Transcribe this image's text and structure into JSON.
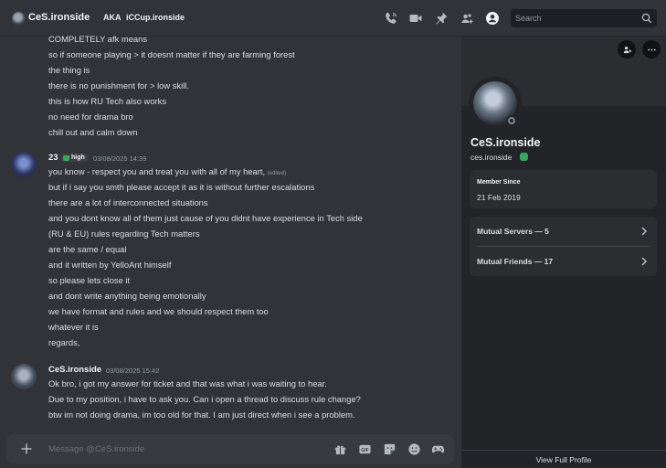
{
  "header": {
    "name": "CeS.ironside",
    "aka_label": "AKA",
    "alias": "iCCup.ironside",
    "icons": [
      "voice-call-icon",
      "video-call-icon",
      "pin-icon",
      "add-friends-icon",
      "user-profile-icon"
    ],
    "search_placeholder": "Search"
  },
  "messages": {
    "block0": [
      "COMPLETELY afk means",
      "so if someone playing > it doesnt matter if they are farming forest",
      "the thing is",
      "there is no punishment for > low skill.",
      "this is how RU Tech also works",
      "no need for drama bro",
      "chill out and calm down"
    ],
    "msg1": {
      "author": "23",
      "tag": "high",
      "timestamp": "03/08/2025 14:39",
      "first_line": "you know - respect you and treat you with all of my heart,",
      "edited": "(edited)",
      "lines": [
        "but if i say you smth please accept it as it is without further escalations",
        "there are a lot of interconnected situations",
        "and you dont know all of them just cause of you didnt have experience in Tech side",
        "(RU & EU) rules regarding Tech matters",
        "are the same / equal",
        "and it written by YelloAnt himself",
        "so please lets close it",
        "and dont write anything being emotionally",
        "we have format and rules and we should respect them too",
        "whatever it is",
        "regards,"
      ]
    },
    "msg2": {
      "author": "CeS.ironside",
      "timestamp": "03/08/2025 15:42",
      "lines": [
        "Ok bro, i got my answer for ticket and that was what i was waiting to hear.",
        "Due to my position, i have to ask you. Can i open a thread to discuss rule change?",
        "btw im not doing drama, im too old for that. I am just direct when i see a problem."
      ]
    }
  },
  "composer": {
    "placeholder": "Message @CeS.ironside",
    "icons": [
      "gift-icon",
      "gif-icon",
      "sticker-icon",
      "emoji-icon",
      "activities-icon"
    ]
  },
  "profile": {
    "display_name": "CeS.ironside",
    "username": "ces.ironside",
    "member_since_label": "Member Since",
    "member_since": "21 Feb 2019",
    "mutual_servers": "Mutual Servers — 5",
    "mutual_friends": "Mutual Friends — 17",
    "view_full": "View Full Profile"
  },
  "colors": {
    "background": "#313338",
    "panel": "#232428",
    "card": "#2b2d31",
    "online_badge": "#3ba55c"
  }
}
